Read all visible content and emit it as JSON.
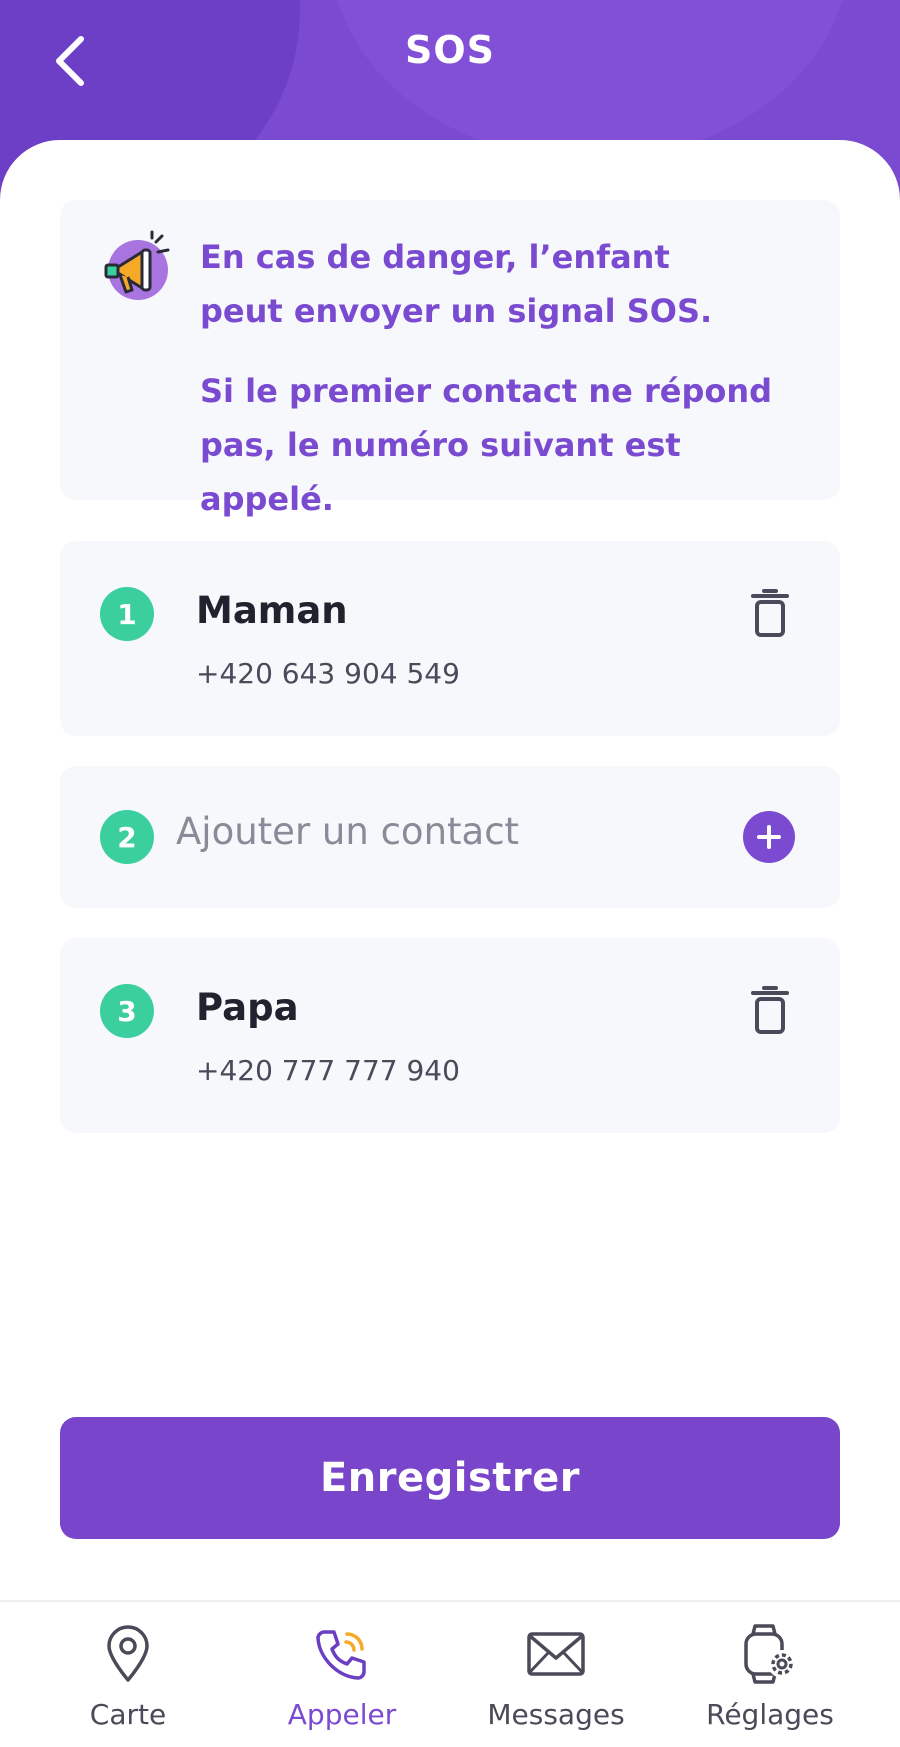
{
  "header": {
    "title": "SOS"
  },
  "info": {
    "line1": "En cas de danger, l’enfant",
    "line2": "peut envoyer un signal SOS.",
    "line3": "Si le premier contact ne répond",
    "line4": "pas, le numéro suivant est appelé."
  },
  "contacts": [
    {
      "index": "1",
      "name": "Maman",
      "phone": "+420 643 904 549"
    },
    {
      "index": "2",
      "placeholder": "Ajouter un contact"
    },
    {
      "index": "3",
      "name": "Papa",
      "phone": "+420 777 777 940"
    }
  ],
  "save_label": "Enregistrer",
  "tabs": [
    {
      "label": "Carte",
      "icon": "map-pin-icon"
    },
    {
      "label": "Appeler",
      "icon": "phone-call-icon",
      "active": true
    },
    {
      "label": "Messages",
      "icon": "envelope-icon"
    },
    {
      "label": "Réglages",
      "icon": "watch-settings-icon"
    }
  ],
  "colors": {
    "primary": "#7a4bd0",
    "accent": "#3ccf9e",
    "card": "#f7f8fc"
  }
}
